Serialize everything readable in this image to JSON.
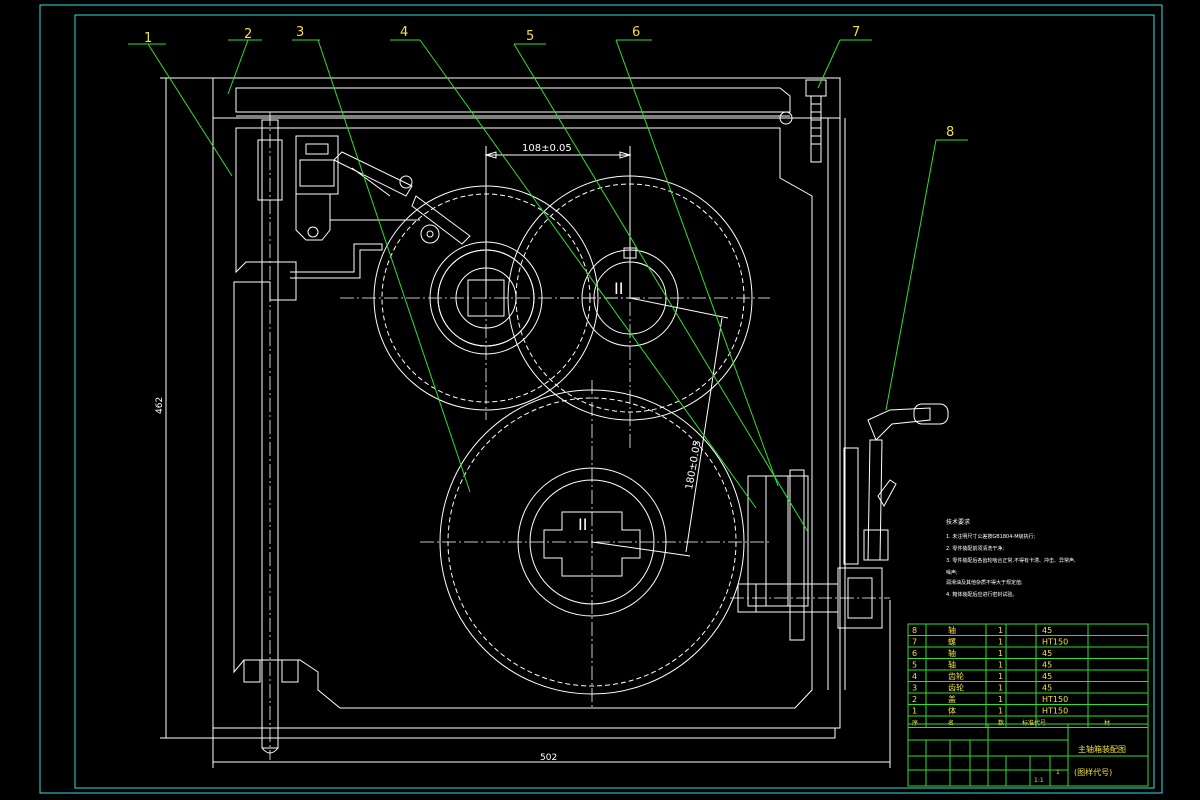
{
  "part_labels": [
    "1",
    "2",
    "3",
    "4",
    "5",
    "6",
    "7",
    "8"
  ],
  "dimensions": {
    "gear_spacing": "108±0.05",
    "shaft_spacing": "180±0.05",
    "overall_height": "462",
    "overall_width": "502"
  },
  "shaft_labels": {
    "shaft_top_right": "II",
    "shaft_bottom": "II"
  },
  "technical_requirements": {
    "title": "技术要求",
    "lines": [
      "1. 未注明尺寸公差按GB1804-M级执行;",
      "2. 零件装配前须清洗干净;",
      "3. 零件装配后各齿轮啮合正常,不得有卡滞、冲击、异常声,",
      "噪声;",
      "润滑油及其他杂质不得大于规定值;",
      "4. 箱体装配后应进行密封试验。"
    ]
  },
  "parts_table": {
    "rows": [
      {
        "seq": "8",
        "name": "轴",
        "qty": "1",
        "material": "45"
      },
      {
        "seq": "7",
        "name": "螺",
        "qty": "1",
        "material": "HT150"
      },
      {
        "seq": "6",
        "name": "轴",
        "qty": "1",
        "material": "45"
      },
      {
        "seq": "5",
        "name": "轴",
        "qty": "1",
        "material": "45"
      },
      {
        "seq": "4",
        "name": "齿轮",
        "qty": "1",
        "material": "45"
      },
      {
        "seq": "3",
        "name": "齿轮",
        "qty": "1",
        "material": "45"
      },
      {
        "seq": "2",
        "name": "盖",
        "qty": "1",
        "material": "HT150"
      },
      {
        "seq": "1",
        "name": "体",
        "qty": "1",
        "material": "HT150"
      }
    ],
    "header": {
      "seq": "序",
      "name": "名",
      "qty": "数",
      "std": "标准代号",
      "material": "材"
    }
  },
  "title_block": {
    "drawing_title": "主轴箱装配图",
    "drawing_code": "(图样代号)",
    "scale": "1:1",
    "sheet": "1"
  },
  "colors": {
    "background": "#000000",
    "geometry": "#ffffff",
    "leader": "#2de02d",
    "frame": "#34e0e0",
    "annotation": "#f0e040"
  }
}
